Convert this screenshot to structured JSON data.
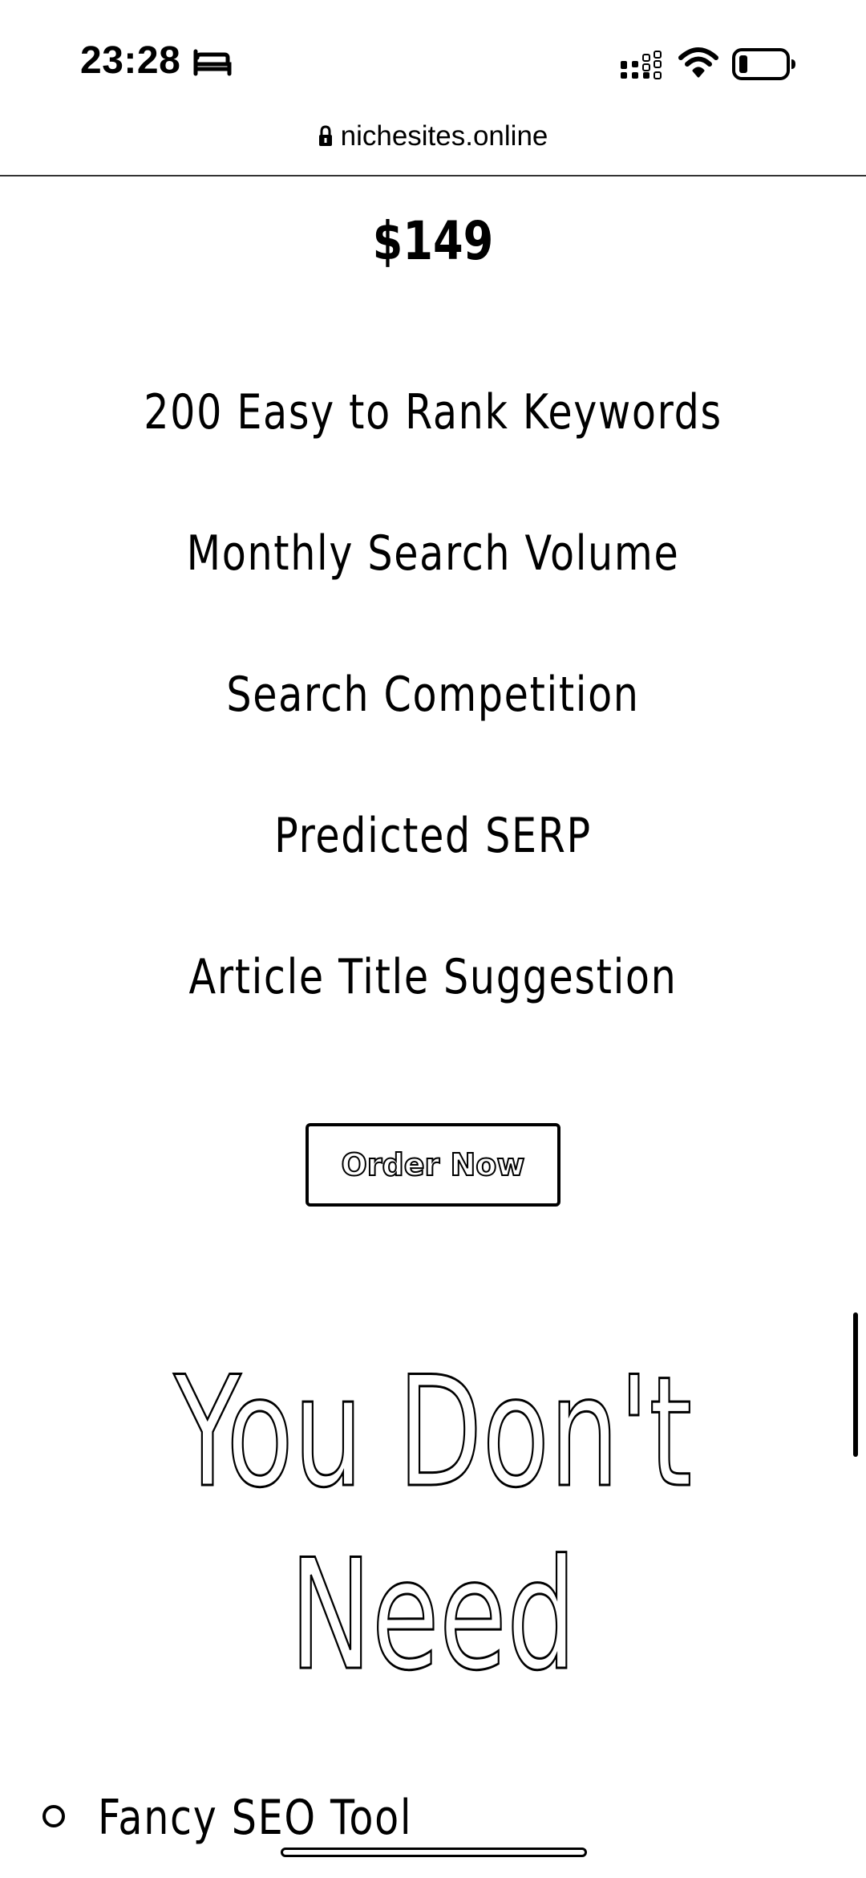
{
  "status_bar": {
    "time": "23:28",
    "icons": [
      "bed-icon",
      "signal-icon",
      "wifi-icon",
      "battery-icon"
    ]
  },
  "browser": {
    "url": "nichesites.online",
    "lock_icon": "lock-icon"
  },
  "pricing": {
    "price": "$149",
    "features": [
      "200 Easy to Rank Keywords",
      "Monthly Search Volume",
      "Search Competition",
      "Predicted SERP",
      "Article Title Suggestion"
    ],
    "order_button": "Order Now"
  },
  "headline": {
    "line1": "You Don't",
    "line2": "Need"
  },
  "list": {
    "items": [
      "Fancy SEO Tool"
    ]
  },
  "colors": {
    "text": "#000000",
    "background": "#ffffff"
  }
}
